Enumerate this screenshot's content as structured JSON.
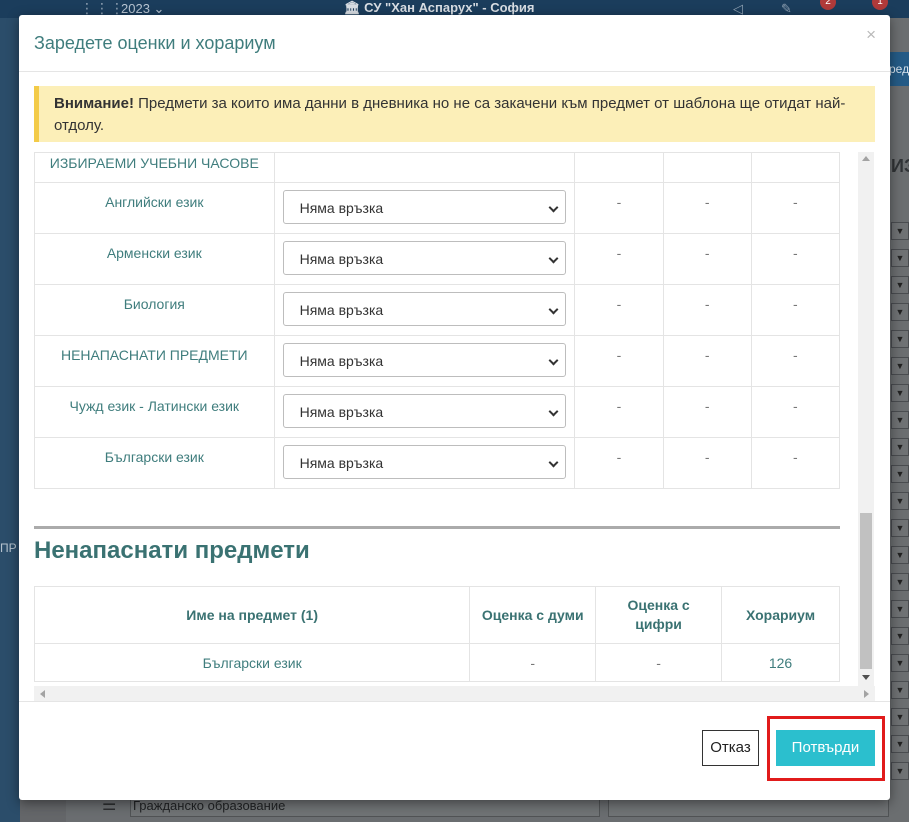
{
  "background": {
    "year": "2023",
    "school": "СУ \"Хан Аспарух\" - София",
    "badges": [
      "2",
      "1"
    ],
    "left_partial": "ПР",
    "right_partial_header": "ред",
    "right_partial_heading": "ИЗ",
    "bottom_field": "Гражданско образование"
  },
  "modal": {
    "title": "Заредете оценки и хорариум",
    "close": "×",
    "alert": {
      "bold": "Внимание!",
      "text": " Предмети за които има данни в дневника но не са закачени към предмет от шаблона ще отидат най-отдолу."
    },
    "mapping_rows": [
      {
        "name": "ИЗБИРАЕМИ УЧЕБНИ ЧАСОВЕ",
        "select": null,
        "c1": "",
        "c2": "",
        "c3": ""
      },
      {
        "name": "Английски език",
        "select": "Няма връзка",
        "c1": "-",
        "c2": "-",
        "c3": "-"
      },
      {
        "name": "Арменски език",
        "select": "Няма връзка",
        "c1": "-",
        "c2": "-",
        "c3": "-"
      },
      {
        "name": "Биология",
        "select": "Няма връзка",
        "c1": "-",
        "c2": "-",
        "c3": "-"
      },
      {
        "name": "НЕНАПАСНАТИ ПРЕДМЕТИ",
        "select": "Няма връзка",
        "c1": "-",
        "c2": "-",
        "c3": "-"
      },
      {
        "name": "Чужд език - Латински език",
        "select": "Няма връзка",
        "c1": "-",
        "c2": "-",
        "c3": "-"
      },
      {
        "name": "Български език",
        "select": "Няма връзка",
        "c1": "-",
        "c2": "-",
        "c3": "-"
      }
    ],
    "unmatched": {
      "title": "Ненапаснати предмети",
      "headers": [
        "Име на предмет (1)",
        "Оценка с думи",
        "Оценка с цифри",
        "Хорариум"
      ],
      "rows": [
        [
          "Български език",
          "-",
          "-",
          "126"
        ]
      ]
    },
    "footer": {
      "cancel": "Отказ",
      "confirm": "Потвърди"
    }
  },
  "colors": {
    "accent": "#2bbfce",
    "title_teal": "#3f7d7d",
    "alert_bg": "#fcefb8",
    "alert_border": "#f3cb48",
    "highlight": "#e11b1b"
  }
}
